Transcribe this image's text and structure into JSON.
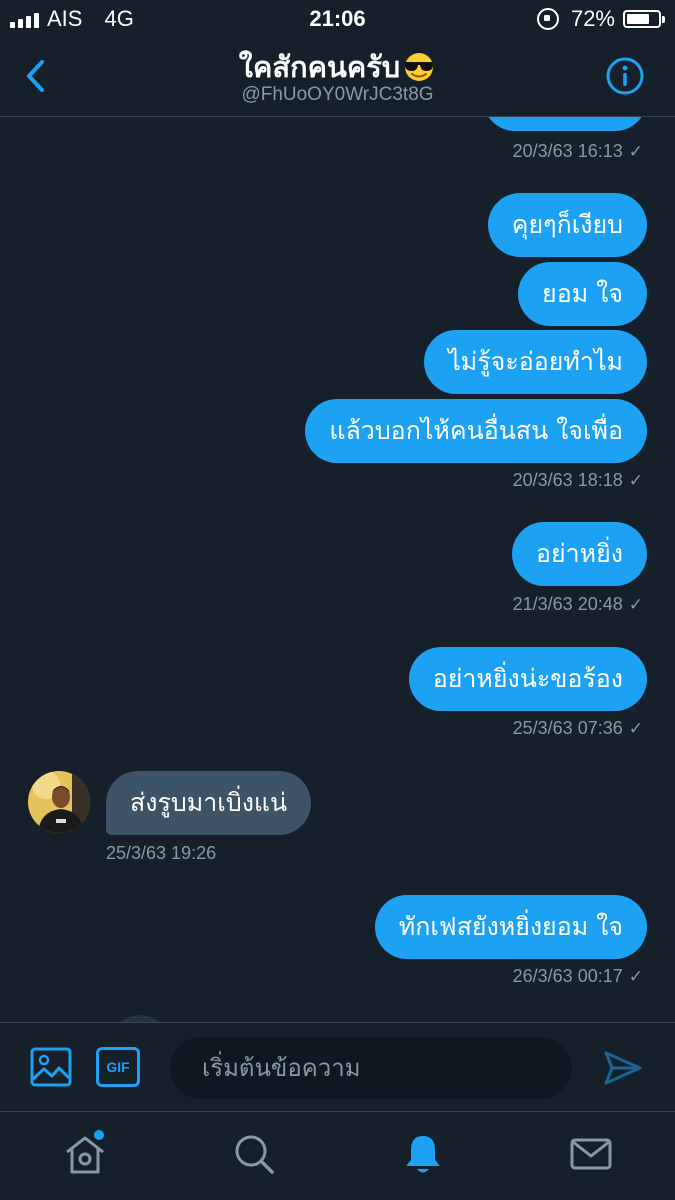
{
  "status_bar": {
    "carrier": "AIS",
    "network": "4G",
    "time": "21:06",
    "battery": "72%",
    "battery_level": 0.72
  },
  "header": {
    "title": "ใคสักคนครับ",
    "title_emoji": "smiling-face-with-sunglasses",
    "handle": "@FhUoOY0WrJC3t8G",
    "back_icon": "chevron-left-icon",
    "info_icon": "info-icon"
  },
  "messages": [
    {
      "type": "sent",
      "lines": [
        "คุยๆก็เงียบ",
        "ยอม ใจ",
        "ไม่รู้จะอ่อยทำไม",
        "แล้วบอกไห้คนอื่นสน ใจเพื่อ"
      ],
      "timestamp": "20/3/63 18:18",
      "status": "✓"
    },
    {
      "type": "sent",
      "lines": [
        "อย่าหยิ่ง"
      ],
      "timestamp": "21/3/63 20:48",
      "status": "✓"
    },
    {
      "type": "sent",
      "lines": [
        "อย่าหยิ่งน่ะขอร้อง"
      ],
      "timestamp": "25/3/63 07:36",
      "status": "✓"
    },
    {
      "type": "received",
      "lines": [
        "ส่งรูบมาเบิ่งแน่"
      ],
      "timestamp": "25/3/63 19:26"
    },
    {
      "type": "sent",
      "lines": [
        "ทักเฟสยังหยิ่งยอม ใจ"
      ],
      "timestamp": "26/3/63 00:17",
      "status": "✓"
    }
  ],
  "previous_timestamp": "20/3/63 16:13",
  "composer": {
    "gif_label": "GIF",
    "placeholder": "เริ่มต้นข้อความ"
  },
  "tabs": [
    "home-icon",
    "search-icon",
    "notifications-bell-icon",
    "messages-envelope-icon"
  ],
  "colors": {
    "background": "#15202b",
    "accent": "#1da1f2",
    "incoming_bubble": "#3d5466",
    "muted_text": "#8899a6",
    "divider": "#38444d"
  }
}
